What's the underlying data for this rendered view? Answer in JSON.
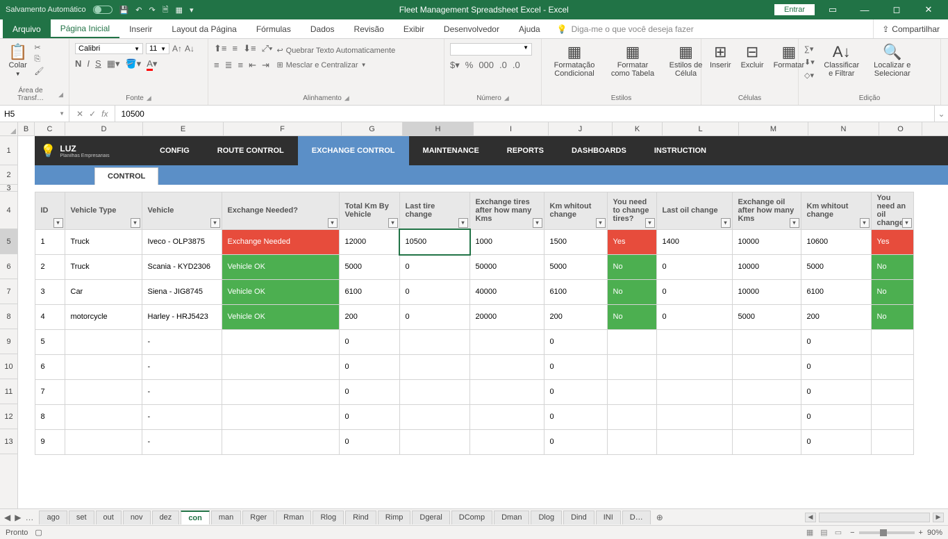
{
  "titlebar": {
    "autosave": "Salvamento Automático",
    "title": "Fleet Management Spreadsheet Excel  -  Excel",
    "entrar": "Entrar"
  },
  "ribbon_tabs": [
    "Arquivo",
    "Página Inicial",
    "Inserir",
    "Layout da Página",
    "Fórmulas",
    "Dados",
    "Revisão",
    "Exibir",
    "Desenvolvedor",
    "Ajuda"
  ],
  "tell_me": "Diga-me o que você deseja fazer",
  "share": "Compartilhar",
  "ribbon": {
    "clipboard_label": "Área de Transf…",
    "paste": "Colar",
    "font_label": "Fonte",
    "font_name": "Calibri",
    "font_size": "11",
    "align_label": "Alinhamento",
    "wrap": "Quebrar Texto Automaticamente",
    "merge": "Mesclar e Centralizar",
    "number_label": "Número",
    "styles_label": "Estilos",
    "cond": "Formatação Condicional",
    "tbl": "Formatar como Tabela",
    "cellst": "Estilos de Célula",
    "cells_label": "Células",
    "insert": "Inserir",
    "delete": "Excluir",
    "format": "Formatar",
    "edit_label": "Edição",
    "sort": "Classificar e Filtrar",
    "find": "Localizar e Selecionar"
  },
  "formula_bar": {
    "name_box": "H5",
    "value": "10500"
  },
  "columns": [
    "B",
    "C",
    "D",
    "E",
    "F",
    "G",
    "H",
    "I",
    "J",
    "K",
    "L",
    "M",
    "N",
    "O"
  ],
  "selected_col": "H",
  "row_labels": [
    "1",
    "2",
    "3",
    "4",
    "5",
    "6",
    "7",
    "8",
    "9",
    "10",
    "11",
    "12",
    "13"
  ],
  "selected_row": "5",
  "logo_main": "LUZ",
  "logo_sub": "Planilhas Empresariais",
  "nav": [
    "CONFIG",
    "ROUTE CONTROL",
    "EXCHANGE CONTROL",
    "MAINTENANCE",
    "REPORTS",
    "DASHBOARDS",
    "INSTRUCTION"
  ],
  "nav_active": 2,
  "subtab": "CONTROL",
  "headers": [
    "ID",
    "Vehicle Type",
    "Vehicle",
    "Exchange Needed?",
    "Total Km By Vehicle",
    "Last tire change",
    "Exchange tires after how many Kms",
    "Km whitout change",
    "You need to change tires?",
    "Last oil change",
    "Exchange oil after how many Kms",
    "Km whitout change",
    "You need an oil change"
  ],
  "rows": [
    {
      "id": "1",
      "type": "Truck",
      "veh": "Iveco - OLP3875",
      "exch": "Exchange Needed",
      "exchCls": "red",
      "km": "12000",
      "tire": "10500",
      "tireKm": "1000",
      "tireWo": "1500",
      "tireNeed": "Yes",
      "tireCls": "red",
      "oil": "1400",
      "oilKm": "10000",
      "oilWo": "10600",
      "oilNeed": "Yes",
      "oilCls": "red"
    },
    {
      "id": "2",
      "type": "Truck",
      "veh": "Scania - KYD2306",
      "exch": "Vehicle OK",
      "exchCls": "green",
      "km": "5000",
      "tire": "0",
      "tireKm": "50000",
      "tireWo": "5000",
      "tireNeed": "No",
      "tireCls": "green",
      "oil": "0",
      "oilKm": "10000",
      "oilWo": "5000",
      "oilNeed": "No",
      "oilCls": "green"
    },
    {
      "id": "3",
      "type": "Car",
      "veh": "Siena - JIG8745",
      "exch": "Vehicle OK",
      "exchCls": "green",
      "km": "6100",
      "tire": "0",
      "tireKm": "40000",
      "tireWo": "6100",
      "tireNeed": "No",
      "tireCls": "green",
      "oil": "0",
      "oilKm": "10000",
      "oilWo": "6100",
      "oilNeed": "No",
      "oilCls": "green"
    },
    {
      "id": "4",
      "type": "motorcycle",
      "veh": "Harley - HRJ5423",
      "exch": "Vehicle OK",
      "exchCls": "green",
      "km": "200",
      "tire": "0",
      "tireKm": "20000",
      "tireWo": "200",
      "tireNeed": "No",
      "tireCls": "green",
      "oil": "0",
      "oilKm": "5000",
      "oilWo": "200",
      "oilNeed": "No",
      "oilCls": "green"
    },
    {
      "id": "5",
      "type": "",
      "veh": "-",
      "exch": "",
      "exchCls": "",
      "km": "0",
      "tire": "",
      "tireKm": "",
      "tireWo": "0",
      "tireNeed": "",
      "tireCls": "",
      "oil": "",
      "oilKm": "",
      "oilWo": "0",
      "oilNeed": "",
      "oilCls": ""
    },
    {
      "id": "6",
      "type": "",
      "veh": "-",
      "exch": "",
      "exchCls": "",
      "km": "0",
      "tire": "",
      "tireKm": "",
      "tireWo": "0",
      "tireNeed": "",
      "tireCls": "",
      "oil": "",
      "oilKm": "",
      "oilWo": "0",
      "oilNeed": "",
      "oilCls": ""
    },
    {
      "id": "7",
      "type": "",
      "veh": "-",
      "exch": "",
      "exchCls": "",
      "km": "0",
      "tire": "",
      "tireKm": "",
      "tireWo": "0",
      "tireNeed": "",
      "tireCls": "",
      "oil": "",
      "oilKm": "",
      "oilWo": "0",
      "oilNeed": "",
      "oilCls": ""
    },
    {
      "id": "8",
      "type": "",
      "veh": "-",
      "exch": "",
      "exchCls": "",
      "km": "0",
      "tire": "",
      "tireKm": "",
      "tireWo": "0",
      "tireNeed": "",
      "tireCls": "",
      "oil": "",
      "oilKm": "",
      "oilWo": "0",
      "oilNeed": "",
      "oilCls": ""
    },
    {
      "id": "9",
      "type": "",
      "veh": "-",
      "exch": "",
      "exchCls": "",
      "km": "0",
      "tire": "",
      "tireKm": "",
      "tireWo": "0",
      "tireNeed": "",
      "tireCls": "",
      "oil": "",
      "oilKm": "",
      "oilWo": "0",
      "oilNeed": "",
      "oilCls": ""
    }
  ],
  "sheet_tabs": [
    "ago",
    "set",
    "out",
    "nov",
    "dez",
    "con",
    "man",
    "Rger",
    "Rman",
    "Rlog",
    "Rind",
    "Rimp",
    "Dgeral",
    "DComp",
    "Dman",
    "Dlog",
    "Dind",
    "INI",
    "D…"
  ],
  "sheet_active": 5,
  "status": {
    "ready": "Pronto",
    "zoom": "90%"
  }
}
